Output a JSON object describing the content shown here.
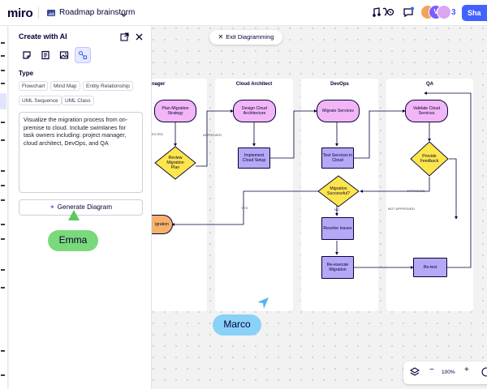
{
  "app": {
    "logo": "miro",
    "board_title": "Roadmap brainstorm",
    "collaborator_count": "3",
    "share_label": "Sha"
  },
  "avatars": [
    {
      "initial": "",
      "color": "#f0a45d"
    },
    {
      "initial": "V",
      "color": "#7a5cff"
    },
    {
      "initial": "",
      "color": "#d9a6f0"
    }
  ],
  "panel": {
    "title": "Create with AI",
    "type_heading": "Type",
    "chips": [
      "Flowchart",
      "Mind Map",
      "Entity Relationship",
      "UML Sequence",
      "UML Class"
    ],
    "prompt": "Visualize the migration process from on-premise to cloud. Include swimlanes for task owners including: project manager, cloud architect, DevOps, and QA",
    "generate_label": "Generate Diagram"
  },
  "canvas": {
    "exit_label": "Exit Diagramming",
    "zoom": "100%"
  },
  "collaborators": [
    {
      "name": "Emma",
      "color": "#7ad97b"
    },
    {
      "name": "Marco",
      "color": "#8ad1f8"
    }
  ],
  "diagram": {
    "lanes": [
      "nager",
      "Cloud Architect",
      "DevOps",
      "QA"
    ],
    "nodes": {
      "plan": "Plan Migration Strategy",
      "review": "Review Migration Plan",
      "migration_partial": "igration",
      "design": "Design Cloud Architecture",
      "implement": "Implement Cloud Setup",
      "migrate": "Migrate Services",
      "test": "Test Services in Cloud",
      "success": "Migration Successful?",
      "resolve": "Resolve Issues",
      "reexecute": "Re-execute Migration",
      "validate": "Validate Cloud Services",
      "feedback": "Provide Feedback",
      "retest": "Re-test"
    },
    "edge_labels": {
      "rejected_partial": "ECTED",
      "approved_1": "APPROVED",
      "yes": "YES",
      "no": "NO",
      "approved_2": "APPROVED",
      "not_approved": "NOT APPROVED"
    }
  }
}
